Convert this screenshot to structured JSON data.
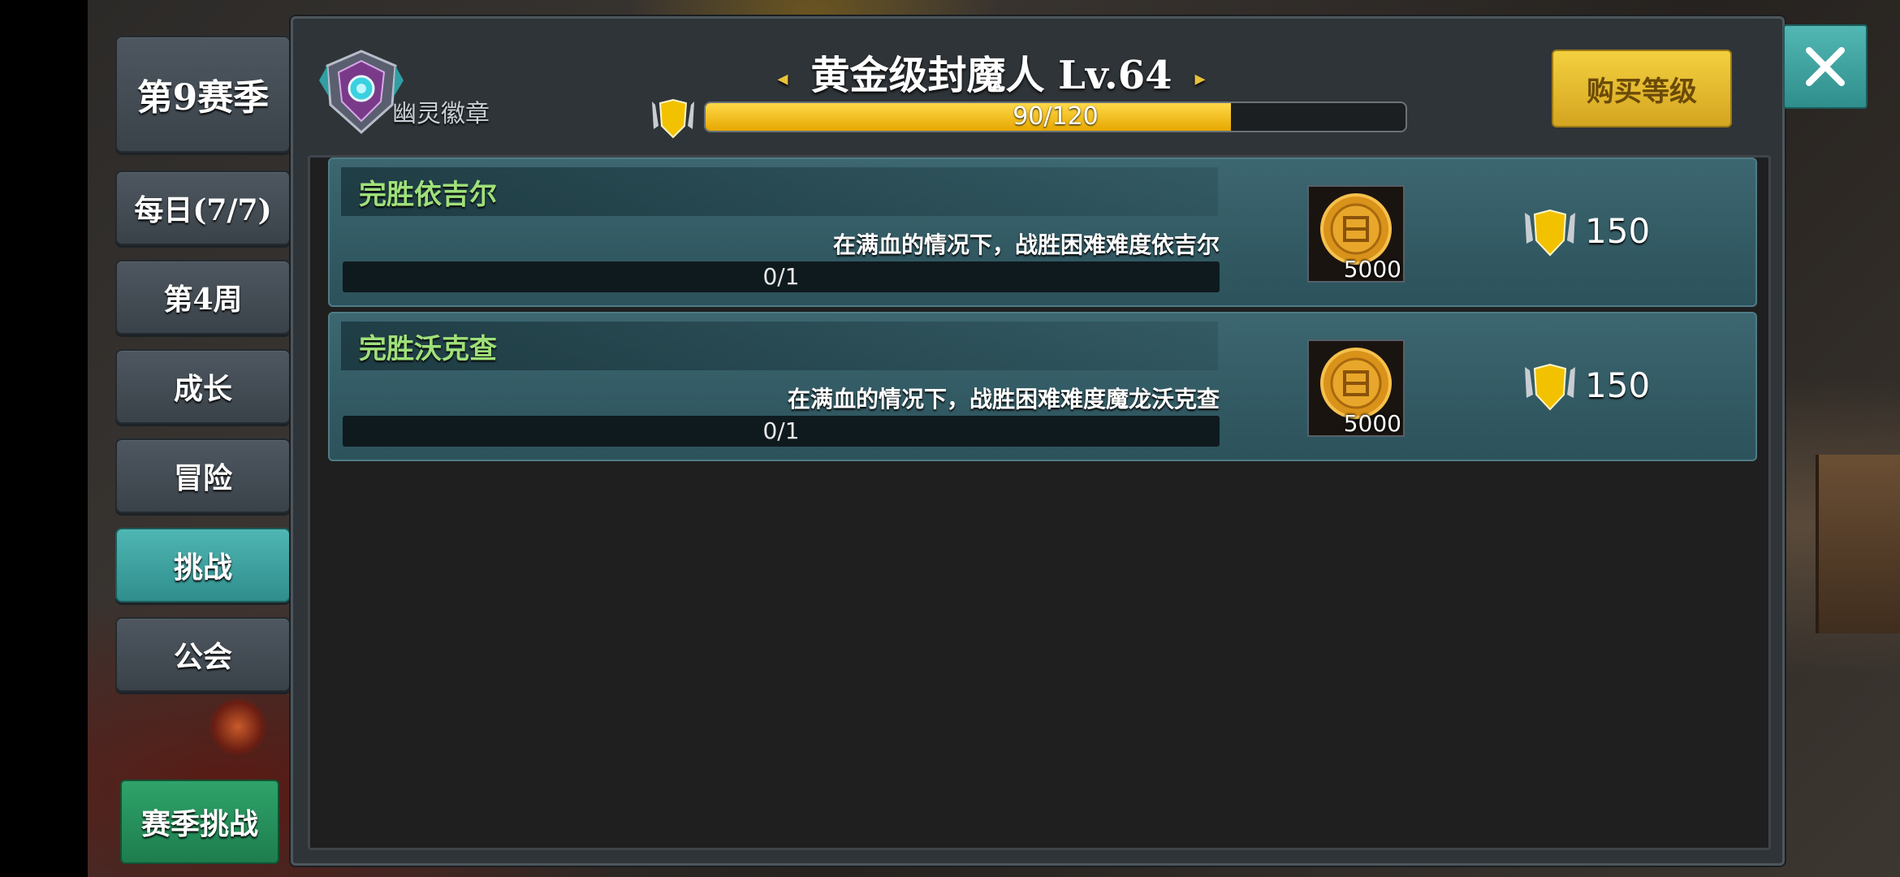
{
  "sidebar": {
    "season_label": "第9赛季",
    "items": [
      {
        "label": "每日(7/7)"
      },
      {
        "label": "第4周"
      },
      {
        "label": "成长"
      },
      {
        "label": "冒险"
      },
      {
        "label": "挑战",
        "active": true
      },
      {
        "label": "公会"
      }
    ],
    "season_challenge_label": "赛季挑战"
  },
  "header": {
    "badge_icon": "ghost-badge-icon",
    "badge_name": "幽灵徽章",
    "rank_title": "黄金级封魔人 Lv.64",
    "xp_current": 90,
    "xp_max": 120,
    "xp_text": "90/120",
    "buy_level_label": "购买等级"
  },
  "tasks": [
    {
      "title": "完胜依吉尔",
      "description": "在满血的情况下，战胜困难难度依吉尔",
      "progress_text": "0/1",
      "reward_icon": "gold-coin-icon",
      "reward_amount": "5000",
      "xp_reward": "150"
    },
    {
      "title": "完胜沃克查",
      "description": "在满血的情况下，战胜困难难度魔龙沃克查",
      "progress_text": "0/1",
      "reward_icon": "gold-coin-icon",
      "reward_amount": "5000",
      "xp_reward": "150"
    }
  ],
  "colors": {
    "accent_teal": "#3fa6a3",
    "xp_gold": "#f2c200",
    "task_title_green": "#9fe07a",
    "buy_button": "#e6bb2e",
    "season_challenge_green": "#259060"
  }
}
